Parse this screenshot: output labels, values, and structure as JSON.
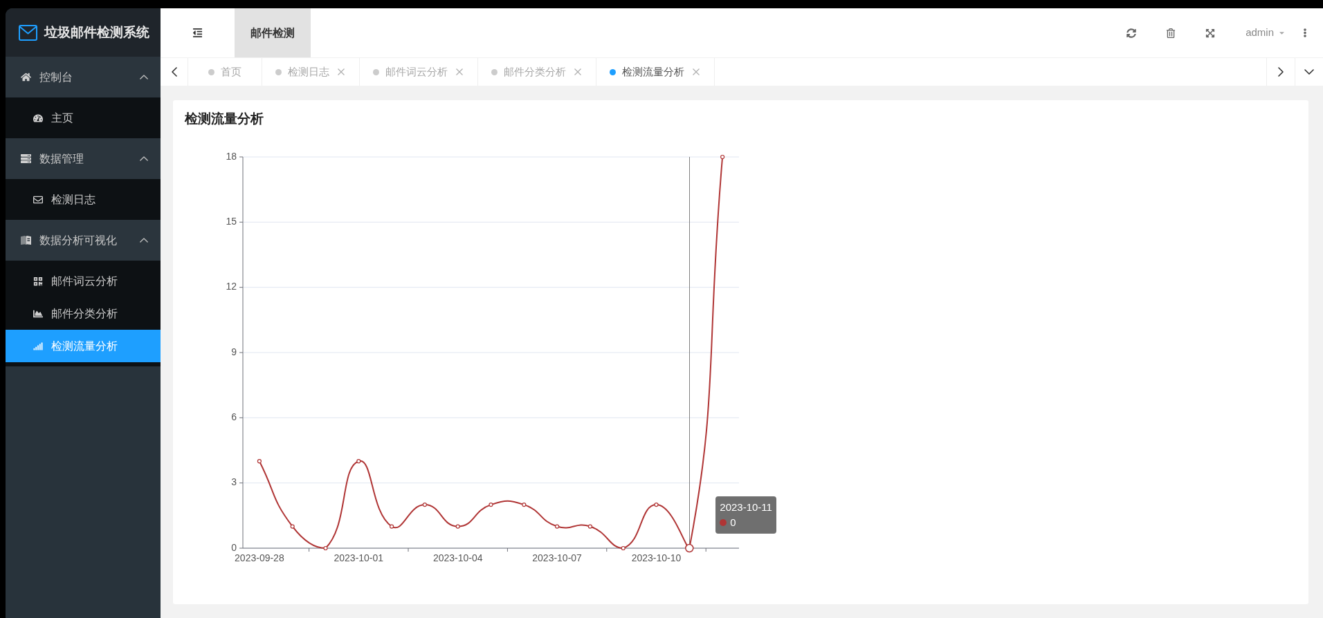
{
  "sidebar": {
    "title": "垃圾邮件检测系统",
    "groups": [
      {
        "label": "控制台",
        "expanded": true,
        "children": [
          {
            "label": "主页",
            "selected": false
          }
        ]
      },
      {
        "label": "数据管理",
        "expanded": true,
        "children": [
          {
            "label": "检测日志",
            "selected": false
          }
        ]
      },
      {
        "label": "数据分析可视化",
        "expanded": true,
        "children": [
          {
            "label": "邮件词云分析",
            "selected": false
          },
          {
            "label": "邮件分类分析",
            "selected": false
          },
          {
            "label": "检测流量分析",
            "selected": true
          }
        ]
      }
    ]
  },
  "header": {
    "nav": [
      {
        "label": "邮件检测",
        "selected": true
      }
    ],
    "user": "admin"
  },
  "tabs": [
    {
      "label": "首页",
      "selected": false,
      "closable": false
    },
    {
      "label": "检测日志",
      "selected": false,
      "closable": true
    },
    {
      "label": "邮件词云分析",
      "selected": false,
      "closable": true
    },
    {
      "label": "邮件分类分析",
      "selected": false,
      "closable": true
    },
    {
      "label": "检测流量分析",
      "selected": true,
      "closable": true
    }
  ],
  "chart": {
    "title": "检测流量分析",
    "chart_data": {
      "type": "line",
      "categories": [
        "2023-09-28",
        null,
        null,
        "2023-10-01",
        null,
        null,
        "2023-10-04",
        null,
        null,
        "2023-10-07",
        null,
        null,
        "2023-10-10",
        null,
        null
      ],
      "series": [
        {
          "color": "#b03535",
          "marker": "circle",
          "values": [
            4,
            1,
            0,
            4,
            1,
            2,
            1,
            2,
            2,
            1,
            1,
            0,
            2,
            0,
            18
          ]
        }
      ],
      "ylim": [
        0,
        18
      ],
      "yticks": [
        0,
        3,
        6,
        9,
        12,
        15,
        18
      ],
      "grid": true
    },
    "points": [
      {
        "hovered": false
      },
      {
        "hovered": false
      },
      {
        "hovered": false
      },
      {
        "hovered": false
      },
      {
        "hovered": false
      },
      {
        "hovered": false
      },
      {
        "hovered": false
      },
      {
        "hovered": false
      },
      {
        "hovered": false
      },
      {
        "hovered": false
      },
      {
        "hovered": false
      },
      {
        "hovered": false
      },
      {
        "hovered": false
      },
      {
        "hovered": true
      },
      {
        "hovered": false
      }
    ],
    "tooltip": {
      "title": "2023-10-11",
      "value": "0"
    }
  }
}
